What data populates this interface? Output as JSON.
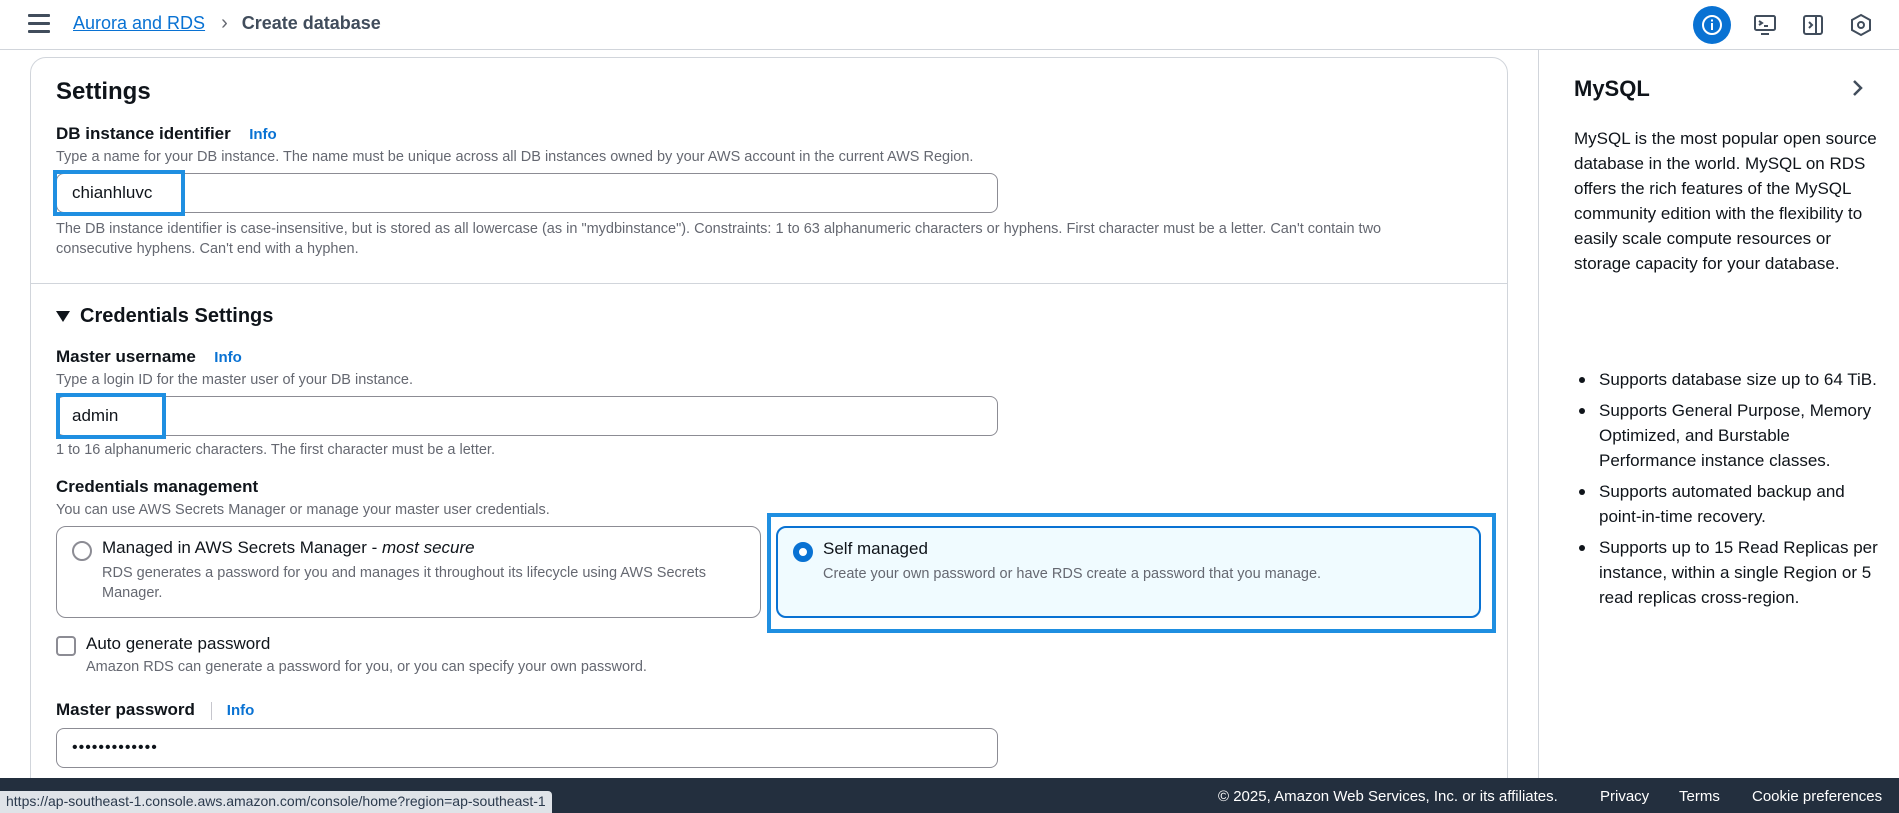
{
  "header": {
    "breadcrumb_parent": "Aurora and RDS",
    "breadcrumb_current": "Create database"
  },
  "settings": {
    "title": "Settings",
    "db_identifier": {
      "label": "DB instance identifier",
      "info": "Info",
      "description": "Type a name for your DB instance. The name must be unique across all DB instances owned by your AWS account in the current AWS Region.",
      "value": "chianhluvc",
      "constraint_line1": "The DB instance identifier is case-insensitive, but is stored as all lowercase (as in \"mydbinstance\"). Constraints: 1 to 63 alphanumeric characters or hyphens. First character must be a letter. Can't contain two",
      "constraint_line2": "consecutive hyphens. Can't end with a hyphen."
    }
  },
  "credentials": {
    "section_title": "Credentials Settings",
    "master_username": {
      "label": "Master username",
      "info": "Info",
      "description": "Type a login ID for the master user of your DB instance.",
      "value": "admin",
      "constraint": "1 to 16 alphanumeric characters. The first character must be a letter."
    },
    "management": {
      "label": "Credentials management",
      "description": "You can use AWS Secrets Manager or manage your master user credentials.",
      "option_managed_title": "Managed in AWS Secrets Manager - ",
      "option_managed_title_em": "most secure",
      "option_managed_desc_line1": "RDS generates a password for you and manages it throughout its lifecycle using AWS Secrets",
      "option_managed_desc_line2": "Manager.",
      "option_self_title": "Self managed",
      "option_self_desc": "Create your own password or have RDS create a password that you manage.",
      "selected": "self"
    },
    "auto_generate": {
      "label": "Auto generate password",
      "description": "Amazon RDS can generate a password for you, or you can specify your own password.",
      "checked": false
    },
    "master_password": {
      "label": "Master password",
      "info": "Info",
      "value": "•••••••••••••"
    }
  },
  "help_panel": {
    "title": "MySQL",
    "body": "MySQL is the most popular open source database in the world. MySQL on RDS offers the rich features of the MySQL community edition with the flexibility to easily scale compute resources or storage capacity for your database.",
    "bullets": [
      "Supports database size up to 64 TiB.",
      "Supports General Purpose, Memory Optimized, and Burstable Performance instance classes.",
      "Supports automated backup and point-in-time recovery.",
      "Supports up to 15 Read Replicas per instance, within a single Region or 5 read replicas cross-region."
    ]
  },
  "footer": {
    "status_url": "https://ap-southeast-1.console.aws.amazon.com/console/home?region=ap-southeast-1",
    "copyright": "© 2025, Amazon Web Services, Inc. or its affiliates.",
    "privacy": "Privacy",
    "terms": "Terms",
    "cookie": "Cookie preferences"
  },
  "colors": {
    "accent": "#0972d3",
    "highlight": "#1f8fe1",
    "footer_bg": "#232f3e"
  }
}
